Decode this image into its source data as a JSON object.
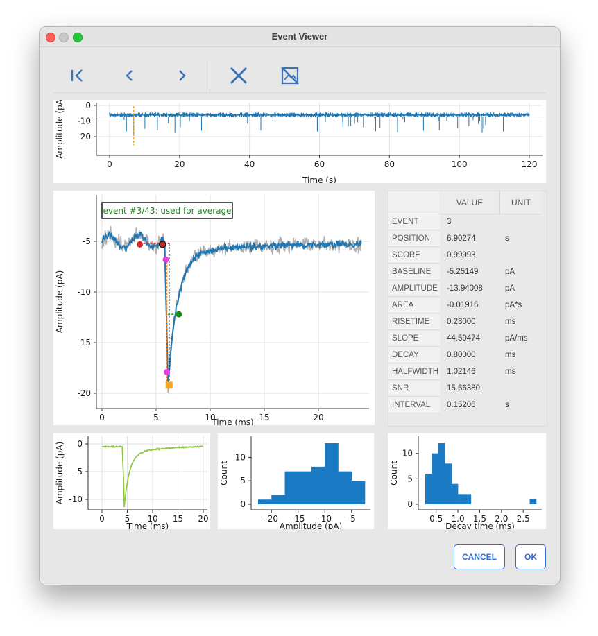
{
  "window": {
    "title": "Event Viewer"
  },
  "toolbar": {
    "first_icon": "skip-to-first-icon",
    "prev_icon": "chevron-left-icon",
    "next_icon": "chevron-right-icon",
    "reject_icon": "close-x-icon",
    "hide_icon": "image-off-icon"
  },
  "overview_plot": {
    "ylabel": "Amplitude (pA",
    "xlabel": "Time (s)",
    "xticks": [
      "0",
      "20",
      "40",
      "60",
      "80",
      "100",
      "120"
    ],
    "yticks": [
      "0",
      "-10",
      "-20"
    ],
    "event_marker_time": 6.9,
    "line_color": "#1f77b4",
    "marker_color": "#f5a623"
  },
  "event_plot": {
    "annotation": "event #3/43: used for average",
    "ylabel": "Amplitude (pA)",
    "xlabel": "Time (ms)",
    "xticks": [
      "0",
      "5",
      "10",
      "15",
      "20"
    ],
    "yticks": [
      "-5",
      "-10",
      "-15",
      "-20"
    ],
    "raw_color": "#9e9e9e",
    "filtered_color": "#1f77b4",
    "annotation_color": "#1a8a1a"
  },
  "table": {
    "headers": [
      "VALUE",
      "UNIT"
    ],
    "rows": [
      {
        "label": "EVENT",
        "value": "3",
        "unit": ""
      },
      {
        "label": "POSITION",
        "value": "6.90274",
        "unit": "s"
      },
      {
        "label": "SCORE",
        "value": "0.99993",
        "unit": ""
      },
      {
        "label": "BASELINE",
        "value": "-5.25149",
        "unit": "pA"
      },
      {
        "label": "AMPLITUDE",
        "value": "-13.94008",
        "unit": "pA"
      },
      {
        "label": "AREA",
        "value": "-0.01916",
        "unit": "pA*s"
      },
      {
        "label": "RISETIME",
        "value": "0.23000",
        "unit": "ms"
      },
      {
        "label": "SLOPE",
        "value": "44.50474",
        "unit": "pA/ms"
      },
      {
        "label": "DECAY",
        "value": "0.80000",
        "unit": "ms"
      },
      {
        "label": "HALFWIDTH",
        "value": "1.02146",
        "unit": "ms"
      },
      {
        "label": "SNR",
        "value": "15.66380",
        "unit": ""
      },
      {
        "label": "INTERVAL",
        "value": "0.15206",
        "unit": "s"
      }
    ]
  },
  "average_plot": {
    "ylabel": "Amplitude (pA)",
    "xlabel": "Time (ms)",
    "xticks": [
      "0",
      "5",
      "10",
      "15",
      "20"
    ],
    "yticks": [
      "0",
      "-5",
      "-10"
    ],
    "line_color": "#8cc63f"
  },
  "chart_data": [
    {
      "type": "bar",
      "xlabel": "Amplitude (pA)",
      "ylabel": "Count",
      "xticks": [
        "-20",
        "-15",
        "-10",
        "-5"
      ],
      "yticks": [
        "0",
        "5",
        "10"
      ],
      "bins": [
        -22.5,
        -20,
        -17.5,
        -15,
        -12.5,
        -10,
        -7.5,
        -5,
        -2.5
      ],
      "values": [
        1,
        2,
        7,
        7,
        8,
        13,
        7,
        5
      ],
      "color": "#1a7bc4"
    },
    {
      "type": "bar",
      "xlabel": "Decay time (ms)",
      "ylabel": "Count",
      "xticks": [
        "0.5",
        "1.0",
        "1.5",
        "2.0",
        "2.5"
      ],
      "yticks": [
        "0",
        "5",
        "10"
      ],
      "bins": [
        0.25,
        0.4,
        0.55,
        0.7,
        0.85,
        1.0,
        1.15,
        1.3,
        1.45,
        1.6,
        1.75,
        1.9,
        2.05,
        2.2,
        2.35,
        2.5,
        2.65,
        2.8
      ],
      "values": [
        6,
        10,
        12,
        8,
        4,
        2,
        2,
        0,
        0,
        0,
        0,
        0,
        0,
        0,
        0,
        0,
        1
      ],
      "color": "#1a7bc4"
    }
  ],
  "buttons": {
    "cancel": "CANCEL",
    "ok": "OK"
  }
}
